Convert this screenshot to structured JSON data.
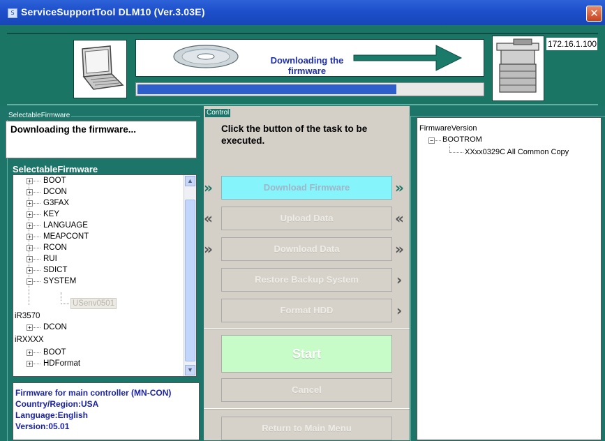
{
  "window": {
    "title": "ServiceSupportTool DLM10 (Ver.3.03E)",
    "close": "✕"
  },
  "header": {
    "status_text": "Downloading the firmware",
    "progress_percent": 75,
    "ip_address": "172.16.1.100"
  },
  "left": {
    "group_label": "SelectableFirmware",
    "download_status": "Downloading the firmware...",
    "tree_heading": "SelectableFirmware",
    "tree": {
      "boot": "BOOT",
      "dcon": "DCON",
      "g3fax": "G3FAX",
      "key": "KEY",
      "language": "LANGUAGE",
      "meapcont": "MEAPCONT",
      "rcon": "RCON",
      "rui": "RUI",
      "sdict": "SDICT",
      "system": "SYSTEM",
      "usenv": "USenv0501",
      "ir3570": "iR3570",
      "ir3570_dcon": "DCON",
      "irxxxx": "iRXXXX",
      "irxxxx_boot": "BOOT",
      "irxxxx_hdformat": "HDFormat"
    },
    "info": {
      "line1": "Firmware for main controller (MN-CON)",
      "line2": "Country/Region:USA",
      "line3": "Language:English",
      "line4": "Version:05.01"
    }
  },
  "control": {
    "group_label": "Control",
    "instruction": "Click the button of the task to be executed.",
    "download_firmware": "Download Firmware",
    "upload_data": "Upload Data",
    "download_data": "Download Data",
    "restore_backup": "Restore Backup System",
    "format_hdd": "Format HDD",
    "start": "Start",
    "cancel": "Cancel",
    "return_main": "Return to Main Menu"
  },
  "right": {
    "title": "FirmwareVersion",
    "bootrom": "BOOTROM",
    "version": "XXxx0329C All Common Copy"
  },
  "icons": {
    "expand": "+",
    "collapse": "−",
    "double_right": "»",
    "double_left": "«",
    "single_right": "›",
    "scroll_up": "▲",
    "scroll_down": "▼"
  },
  "colors": {
    "teal": "#1c7568",
    "active_button": "#86f4fb",
    "start_button": "#c7fbc7",
    "info_text": "#1a22a8",
    "progress": "#2e5ec9"
  }
}
